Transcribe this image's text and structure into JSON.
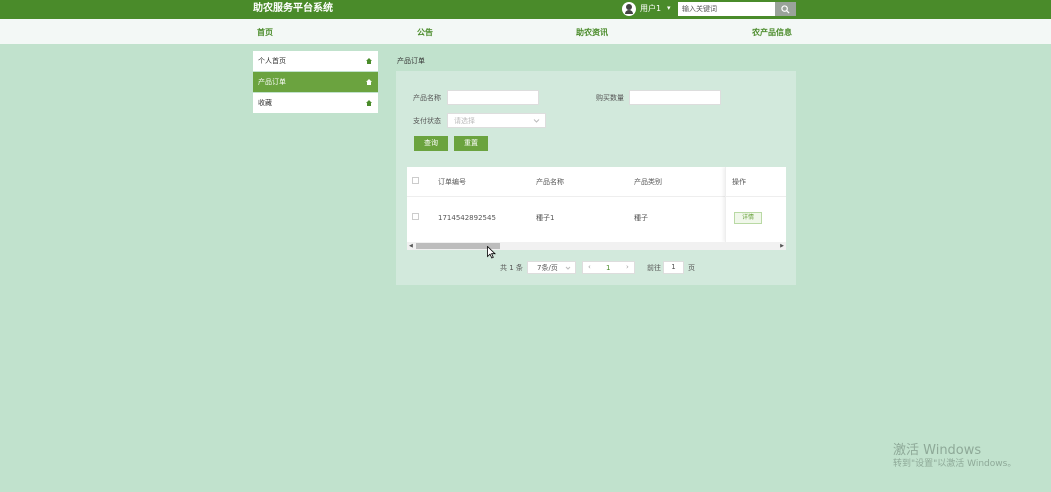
{
  "header": {
    "site_title": "助农服务平台系统",
    "username": "用户1",
    "search_placeholder": "输入关键词"
  },
  "nav": {
    "items": [
      "首页",
      "公告",
      "助农资讯",
      "农产品信息"
    ]
  },
  "sidebar": {
    "items": [
      {
        "label": "个人首页",
        "active": false
      },
      {
        "label": "产品订单",
        "active": true
      },
      {
        "label": "收藏",
        "active": false
      }
    ]
  },
  "main": {
    "heading": "产品订单",
    "filters": {
      "product_name_label": "产品名称",
      "quantity_label": "购买数量",
      "pay_status_label": "支付状态",
      "pay_status_placeholder": "请选择",
      "query_button": "查询",
      "reset_button": "重置"
    },
    "table": {
      "headers": [
        "订单编号",
        "产品名称",
        "产品类别",
        "操作"
      ],
      "rows": [
        {
          "order_no": "1714542892545",
          "product_name": "種子1",
          "category": "種子",
          "action": "详情"
        }
      ]
    },
    "pagination": {
      "total": "共 1 条",
      "page_size": "7条/页",
      "current_page": "1",
      "goto_label": "前往",
      "goto_value": "1",
      "page_unit": "页"
    }
  },
  "watermark": {
    "line1": "激活 Windows",
    "line2": "转到\"设置\"以激活 Windows。"
  },
  "colors": {
    "header_bg": "#4a8b2a",
    "accent": "#6ba33f",
    "page_bg": "#c1e2cd",
    "panel_bg": "#d2e9dc"
  }
}
